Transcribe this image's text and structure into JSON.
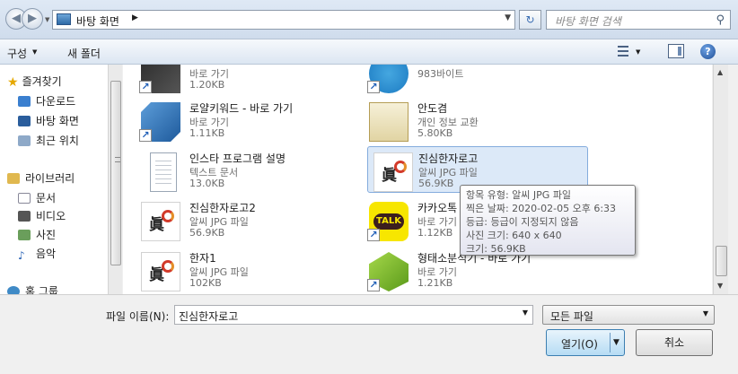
{
  "address": {
    "path": "바탕 화면",
    "search_placeholder": "바탕 화면 검색"
  },
  "toolbar": {
    "organize_label": "구성",
    "new_folder_label": "새 폴더"
  },
  "sidebar": {
    "favorites_label": "즐겨찾기",
    "favorites": [
      {
        "label": "다운로드",
        "icon": "downloads-icon"
      },
      {
        "label": "바탕 화면",
        "icon": "desktop-icon"
      },
      {
        "label": "최근 위치",
        "icon": "recent-places-icon"
      }
    ],
    "libraries_label": "라이브러리",
    "libraries": [
      {
        "label": "문서",
        "icon": "documents-icon"
      },
      {
        "label": "비디오",
        "icon": "videos-icon"
      },
      {
        "label": "사진",
        "icon": "pictures-icon"
      },
      {
        "label": "음악",
        "icon": "music-icon"
      }
    ],
    "homegroup_label": "홈 그룹"
  },
  "files": [
    {
      "name": "",
      "type": "바로 가기",
      "size": "1.20KB",
      "icon": "shortcut-dark-icon"
    },
    {
      "name": "",
      "type": "983바이트",
      "size": "",
      "icon": "telegram-icon"
    },
    {
      "name": "로얄키워드 - 바로 가기",
      "type": "바로 가기",
      "size": "1.11KB",
      "icon": "royal-keyword-icon"
    },
    {
      "name": "안도겸",
      "type": "개인 정보 교환",
      "size": "5.80KB",
      "icon": "personal-info-exchange-icon"
    },
    {
      "name": "인스타 프로그램 설명",
      "type": "텍스트 문서",
      "size": "13.0KB",
      "icon": "text-document-icon"
    },
    {
      "name": "진심한자로고",
      "type": "알씨 JPG 파일",
      "size": "56.9KB",
      "icon": "jpg-image-icon"
    },
    {
      "name": "진심한자로고2",
      "type": "알씨 JPG 파일",
      "size": "56.9KB",
      "icon": "jpg-image-icon"
    },
    {
      "name": "카카오톡",
      "type": "바로 가기",
      "size": "1.12KB",
      "icon": "kakaotalk-icon"
    },
    {
      "name": "한자1",
      "type": "알씨 JPG 파일",
      "size": "102KB",
      "icon": "jpg-image-icon"
    },
    {
      "name": "형태소분석기 - 바로 가기",
      "type": "바로 가기",
      "size": "1.21KB",
      "icon": "morpheme-analyzer-icon"
    }
  ],
  "tooltip": {
    "lines": [
      "항목 유형: 알씨 JPG 파일",
      "찍은 날짜: 2020-02-05 오후 6:33",
      "등급: 등급이 지정되지 않음",
      "사진 크기: 640 x 640",
      "크기: 56.9KB"
    ]
  },
  "bottom": {
    "filename_label": "파일 이름(N):",
    "filename_value": "진심한자로고",
    "filter_value": "모든 파일",
    "open_label": "열기(O)",
    "cancel_label": "취소"
  }
}
